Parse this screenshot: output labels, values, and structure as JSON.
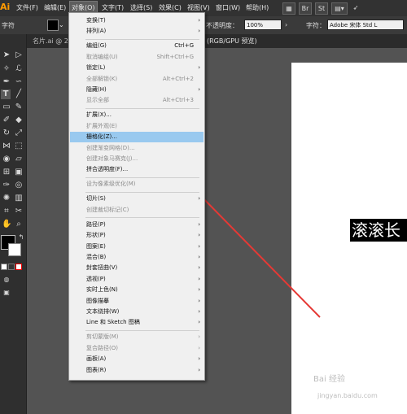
{
  "app": {
    "logo": "Ai"
  },
  "menubar": {
    "items": [
      "文件(F)",
      "编辑(E)",
      "对象(O)",
      "文字(T)",
      "选择(S)",
      "效果(C)",
      "视图(V)",
      "窗口(W)",
      "帮助(H)"
    ],
    "active_index": 2,
    "br_label": "Br",
    "st_label": "St"
  },
  "controlbar": {
    "left_label": "字符",
    "opacity_label": "不透明度：",
    "opacity_value": "100%",
    "char_label": "字符：",
    "font_field": "Adobe 宋体 Std L"
  },
  "tabs": {
    "doc_tab_prefix": "名片.ai @ 2",
    "doc_tab_suffix": "(RGB/GPU 预览)"
  },
  "menu": {
    "items": [
      {
        "label": "变换(T)",
        "shortcut": "",
        "submenu": true,
        "enabled": true
      },
      {
        "label": "排列(A)",
        "shortcut": "",
        "submenu": true,
        "enabled": true
      },
      {
        "sep": true
      },
      {
        "label": "编组(G)",
        "shortcut": "Ctrl+G",
        "submenu": false,
        "enabled": true
      },
      {
        "label": "取消编组(U)",
        "shortcut": "Shift+Ctrl+G",
        "submenu": false,
        "enabled": false
      },
      {
        "label": "锁定(L)",
        "shortcut": "",
        "submenu": true,
        "enabled": true
      },
      {
        "label": "全部解锁(K)",
        "shortcut": "Alt+Ctrl+2",
        "submenu": false,
        "enabled": false
      },
      {
        "label": "隐藏(H)",
        "shortcut": "",
        "submenu": true,
        "enabled": true
      },
      {
        "label": "显示全部",
        "shortcut": "Alt+Ctrl+3",
        "submenu": false,
        "enabled": false
      },
      {
        "sep": true
      },
      {
        "label": "扩展(X)...",
        "shortcut": "",
        "submenu": false,
        "enabled": true
      },
      {
        "label": "扩展外观(E)",
        "shortcut": "",
        "submenu": false,
        "enabled": false
      },
      {
        "label": "栅格化(Z)...",
        "shortcut": "",
        "submenu": false,
        "enabled": true,
        "highlight": true
      },
      {
        "label": "创建渐变网格(D)...",
        "shortcut": "",
        "submenu": false,
        "enabled": false
      },
      {
        "label": "创建对象马赛克(J)...",
        "shortcut": "",
        "submenu": false,
        "enabled": false
      },
      {
        "label": "拼合透明度(F)...",
        "shortcut": "",
        "submenu": false,
        "enabled": true
      },
      {
        "sep": true
      },
      {
        "label": "设为像素级优化(M)",
        "shortcut": "",
        "submenu": false,
        "enabled": false
      },
      {
        "sep": true
      },
      {
        "label": "切片(S)",
        "shortcut": "",
        "submenu": true,
        "enabled": true
      },
      {
        "label": "创建裁切标记(C)",
        "shortcut": "",
        "submenu": false,
        "enabled": false
      },
      {
        "sep": true
      },
      {
        "label": "路径(P)",
        "shortcut": "",
        "submenu": true,
        "enabled": true
      },
      {
        "label": "形状(P)",
        "shortcut": "",
        "submenu": true,
        "enabled": true
      },
      {
        "label": "图案(E)",
        "shortcut": "",
        "submenu": true,
        "enabled": true
      },
      {
        "label": "混合(B)",
        "shortcut": "",
        "submenu": true,
        "enabled": true
      },
      {
        "label": "封套扭曲(V)",
        "shortcut": "",
        "submenu": true,
        "enabled": true
      },
      {
        "label": "透视(P)",
        "shortcut": "",
        "submenu": true,
        "enabled": true
      },
      {
        "label": "实时上色(N)",
        "shortcut": "",
        "submenu": true,
        "enabled": true
      },
      {
        "label": "图像描摹",
        "shortcut": "",
        "submenu": true,
        "enabled": true
      },
      {
        "label": "文本绕排(W)",
        "shortcut": "",
        "submenu": true,
        "enabled": true
      },
      {
        "label": "Line 和 Sketch 图稿",
        "shortcut": "",
        "submenu": true,
        "enabled": true
      },
      {
        "sep": true
      },
      {
        "label": "剪切蒙版(M)",
        "shortcut": "",
        "submenu": true,
        "enabled": false
      },
      {
        "label": "复合路径(O)",
        "shortcut": "",
        "submenu": true,
        "enabled": false
      },
      {
        "label": "画板(A)",
        "shortcut": "",
        "submenu": true,
        "enabled": true
      },
      {
        "label": "图表(R)",
        "shortcut": "",
        "submenu": true,
        "enabled": true
      }
    ]
  },
  "canvas": {
    "text": "滚滚长"
  },
  "watermark": {
    "brand": "Bai 经验",
    "url": "jingyan.baidu.com"
  },
  "colors": {
    "highlight": "#99c9ef",
    "arrow": "#e53935",
    "menu_bg": "#f0f0f0"
  }
}
